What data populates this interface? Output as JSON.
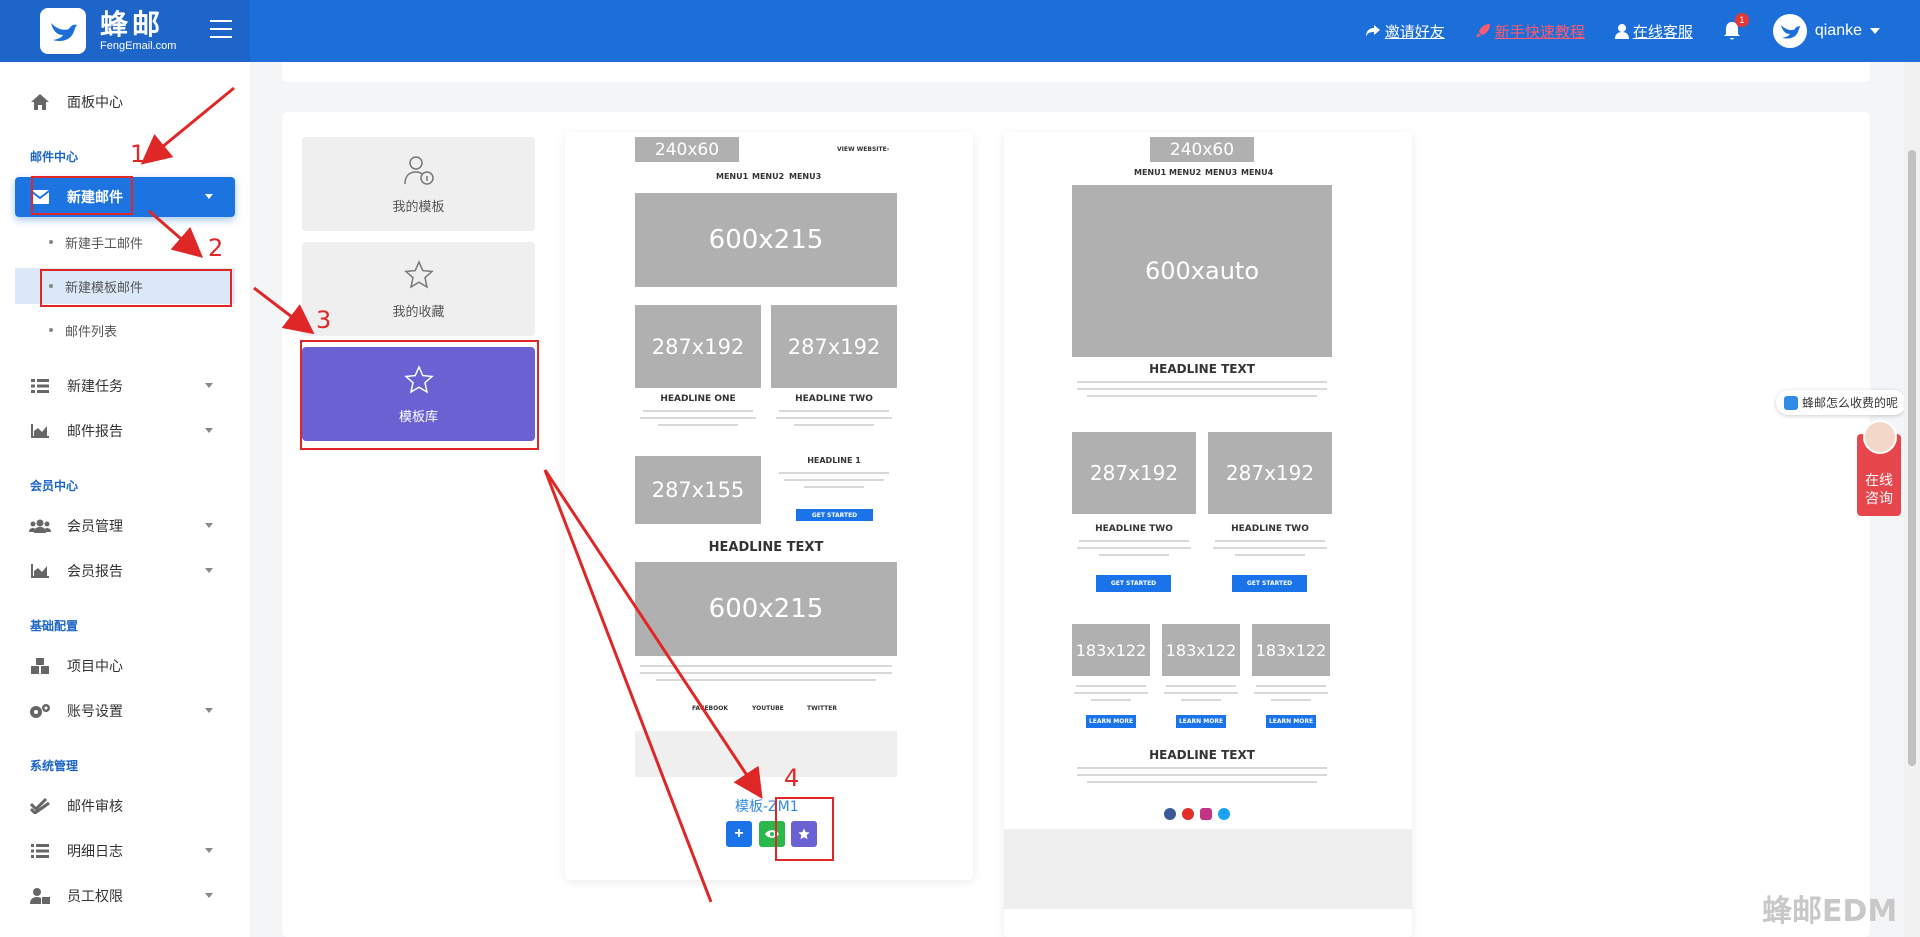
{
  "brand": {
    "name_cn": "蜂邮",
    "name_en": "FengEmail.com"
  },
  "header": {
    "invite": "邀请好友",
    "tutorial": "新手快速教程",
    "support": "在线客服",
    "notifications": "1",
    "username": "qianke"
  },
  "sidebar": {
    "dashboard": "面板中心",
    "section_mail": "邮件中心",
    "new_mail": "新建邮件",
    "new_manual": "新建手工邮件",
    "new_template": "新建模板邮件",
    "mail_list": "邮件列表",
    "new_task": "新建任务",
    "mail_report": "邮件报告",
    "section_member": "会员中心",
    "member_manage": "会员管理",
    "member_report": "会员报告",
    "section_basic": "基础配置",
    "project_center": "项目中心",
    "account_settings": "账号设置",
    "section_system": "系统管理",
    "mail_review": "邮件审核",
    "detail_log": "明细日志",
    "staff_permission": "员工权限"
  },
  "library": {
    "my_templates": "我的模板",
    "my_favorites": "我的收藏",
    "template_library": "模板库"
  },
  "template1": {
    "logo_ph": "240x60",
    "view_website": "VIEW WEBSITE›",
    "menus": [
      "MENU1",
      "MENU2",
      "MENU3"
    ],
    "hero1": "600x215",
    "img_a": "287x192",
    "img_b": "287x192",
    "headline_one": "HEADLINE ONE",
    "headline_two": "HEADLINE TWO",
    "img_c": "287x155",
    "headline_1": "HEADLINE 1",
    "get_started": "GET STARTED",
    "headline_text": "HEADLINE TEXT",
    "hero2": "600x215",
    "social": [
      "FACEBOOK",
      "YOUTUBE",
      "TWITTER"
    ],
    "name": "模板-ZM1"
  },
  "template2": {
    "logo_ph": "240x60",
    "menus": [
      "MENU1",
      "MENU2",
      "MENU3",
      "MENU4"
    ],
    "hero": "600xauto",
    "headline_text": "HEADLINE TEXT",
    "img_a": "287x192",
    "img_b": "287x192",
    "headline_two_a": "HEADLINE TWO",
    "headline_two_b": "HEADLINE TWO",
    "get_started": "GET STARTED",
    "small": [
      "183x122",
      "183x122",
      "183x122"
    ],
    "learn_more": "LEARN MORE",
    "headline_text2": "HEADLINE TEXT"
  },
  "annotations": [
    "1",
    "2",
    "3",
    "4"
  ],
  "float": {
    "question": "蜂邮怎么收费的呢",
    "consult_1": "在线",
    "consult_2": "咨询"
  },
  "watermark": "蜂邮EDM",
  "colors": {
    "primary": "#1c6fd8",
    "active_library": "#6a62d2",
    "annotation": "#e02727"
  }
}
